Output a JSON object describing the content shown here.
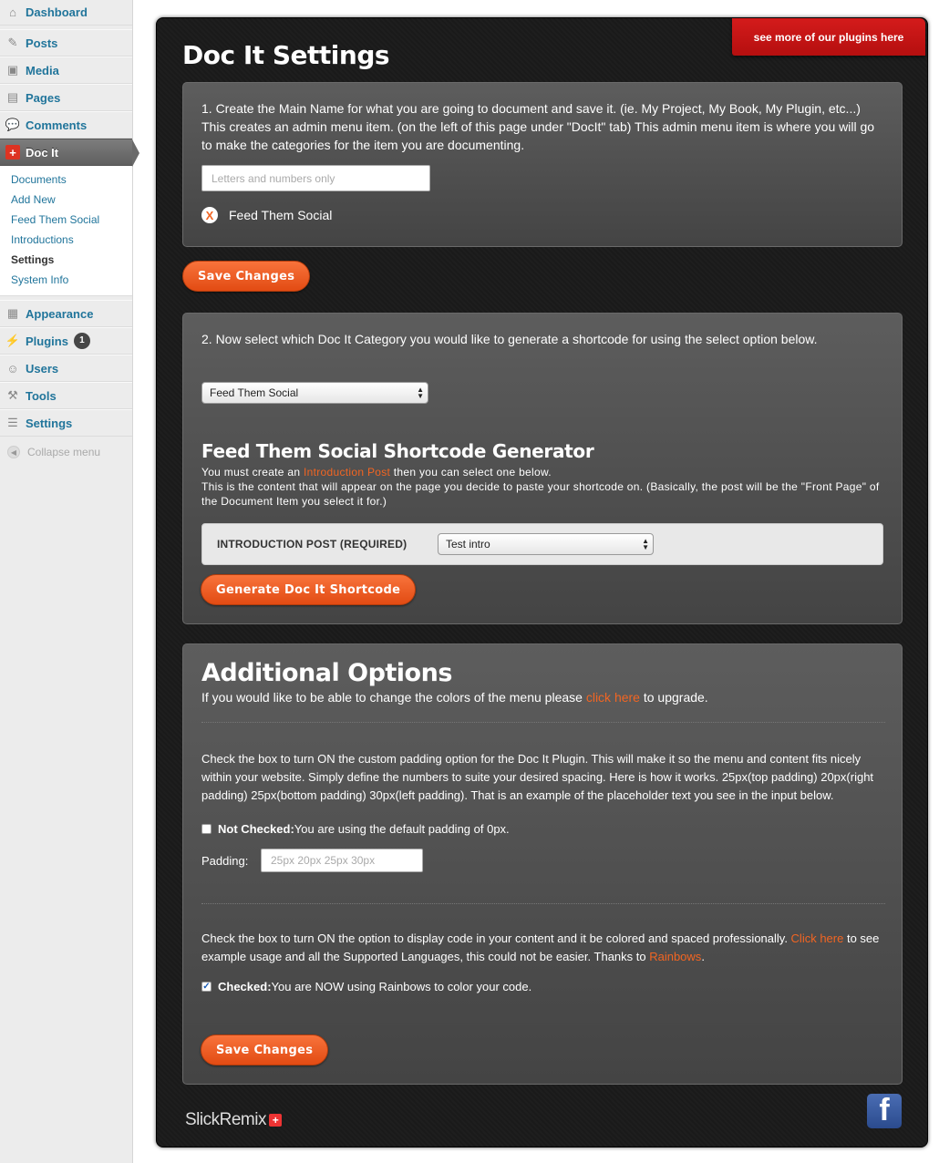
{
  "sidebar": {
    "items": [
      {
        "label": "Dashboard",
        "icon": "house-icon"
      },
      {
        "label": "Posts",
        "icon": "pin-icon"
      },
      {
        "label": "Media",
        "icon": "media-icon"
      },
      {
        "label": "Pages",
        "icon": "pages-icon"
      },
      {
        "label": "Comments",
        "icon": "comment-icon"
      },
      {
        "label": "Doc It",
        "icon": "docit-logo-icon"
      }
    ],
    "submenu": [
      "Documents",
      "Add New",
      "Feed Them Social",
      "Introductions",
      "Settings",
      "System Info"
    ],
    "items2": [
      {
        "label": "Appearance",
        "icon": "appearance-icon"
      },
      {
        "label": "Plugins",
        "icon": "plug-icon",
        "badge": "1"
      },
      {
        "label": "Users",
        "icon": "users-icon"
      },
      {
        "label": "Tools",
        "icon": "tools-icon"
      },
      {
        "label": "Settings",
        "icon": "settings-icon"
      }
    ],
    "collapse": "Collapse menu"
  },
  "header": {
    "ribbon": "see more of our plugins here",
    "title": "Doc It Settings"
  },
  "step1": {
    "text": "1. Create the Main Name for what you are going to document and save it. (ie. My Project, My Book, My Plugin, etc...) This creates an admin menu item. (on the left of this page under \"DocIt\" tab) This admin menu item is where you will go to make the categories for the item you are documenting.",
    "input_placeholder": "Letters and numbers only",
    "existing_item": "Feed Them Social",
    "x_label": "X",
    "save": "Save Changes"
  },
  "step2": {
    "text": "2. Now select which Doc It Category you would like to generate a shortcode for using the select option below.",
    "select_value": "Feed Them Social",
    "gen_title": "Feed Them Social Shortcode Generator",
    "desc_1a": "You must create an ",
    "desc_1link": "Introduction Post",
    "desc_1b": " then you can select one below.",
    "desc_2": "This is the content that will appear on the page you decide to paste your shortcode on. (Basically, the post will be the \"Front Page\" of the Document Item you select it for.)",
    "intro_label": "INTRODUCTION POST (REQUIRED)",
    "intro_value": "Test intro",
    "generate": "Generate Doc It Shortcode"
  },
  "additional": {
    "title": "Additional Options",
    "upgrade_a": "If you would like to be able to change the colors of the menu please ",
    "upgrade_link": "click here",
    "upgrade_b": " to upgrade.",
    "padding_text": "Check the box to turn ON the custom padding option for the Doc It Plugin. This will make it so the menu and content fits nicely within your website. Simply define the numbers to suite your desired spacing. Here is how it works. 25px(top padding) 20px(right padding) 25px(bottom padding) 30px(left padding). That is an example of the placeholder text you see in the input below.",
    "padding_chk_bold": "Not Checked:",
    "padding_chk_text": " You are using the default padding of 0px.",
    "padding_checked": false,
    "padding_label": "Padding:",
    "padding_placeholder": "25px 20px 25px 30px",
    "code_text_a": "Check the box to turn ON the option to display code in your content and it be colored and spaced professionally. ",
    "code_link1": "Click here",
    "code_text_b": " to see example usage and all the Supported Languages, this could not be easier. Thanks to ",
    "code_link2": "Rainbows",
    "code_text_c": ".",
    "code_chk_bold": "Checked:",
    "code_chk_text": " You are NOW using Rainbows to color your code.",
    "code_checked": true,
    "save": "Save Changes"
  },
  "footer": {
    "brand": "SlickRemix",
    "brand_mark": "+",
    "fb_label": "f"
  },
  "colors": {
    "accent": "#f26522",
    "ribbon": "#c8151a",
    "link_blue": "#21759b"
  }
}
